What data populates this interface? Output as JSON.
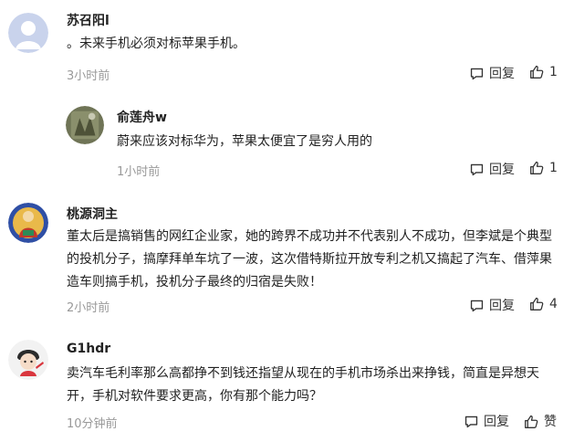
{
  "comments": [
    {
      "name": "苏召阳l",
      "text": "。未来手机必须对标苹果手机。",
      "time": "3小时前",
      "reply_label": "回复",
      "like_count": "1"
    },
    {
      "name": "俞莲舟w",
      "text": "蔚来应该对标华为，苹果太便宜了是穷人用的",
      "time": "1小时前",
      "reply_label": "回复",
      "like_count": "1"
    },
    {
      "name": "桃源洞主",
      "text": "董太后是搞销售的网红企业家，她的跨界不成功并不代表别人不成功，但李斌是个典型的投机分子，搞摩拜单车坑了一波，这次借特斯拉开放专利之机又搞起了汽车、借萍果造车则搞手机，投机分子最终的归宿是失败！",
      "time": "2小时前",
      "reply_label": "回复",
      "like_count": "4"
    },
    {
      "name": "G1hdr",
      "text": "卖汽车毛利率那么高都挣不到钱还指望从现在的手机市场杀出来挣钱，简直是异想天开，手机对软件要求更高，你有那个能力吗？",
      "time": "10分钟前",
      "reply_label": "回复",
      "like_count": "赞"
    }
  ],
  "icons": {
    "reply": "comment-bubble-icon",
    "like": "thumbs-up-icon"
  },
  "colors": {
    "name": "#222222",
    "meta": "#999999",
    "text": "#222222"
  }
}
